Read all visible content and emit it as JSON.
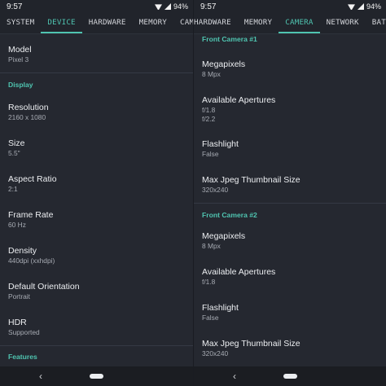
{
  "left": {
    "status": {
      "time": "9:57",
      "battery": "94%"
    },
    "tabs": [
      "SYSTEM",
      "DEVICE",
      "HARDWARE",
      "MEMORY",
      "CAMERA"
    ],
    "model": {
      "label": "Model",
      "value": "Pixel 3"
    },
    "display_section": "Display",
    "display_items": [
      {
        "label": "Resolution",
        "value": "2160 x 1080"
      },
      {
        "label": "Size",
        "value": "5.5\""
      },
      {
        "label": "Aspect Ratio",
        "value": "2:1"
      },
      {
        "label": "Frame Rate",
        "value": "60 Hz"
      },
      {
        "label": "Density",
        "value": "440dpi (xxhdpi)"
      },
      {
        "label": "Default Orientation",
        "value": "Portrait"
      },
      {
        "label": "HDR",
        "value": "Supported"
      }
    ],
    "features_section": "Features",
    "nav": {
      "back_icon": "‹"
    }
  },
  "right": {
    "status": {
      "time": "9:57",
      "battery": "94%"
    },
    "tabs": [
      "HARDWARE",
      "MEMORY",
      "CAMERA",
      "NETWORK",
      "BATTERY"
    ],
    "camera1": {
      "title": "Front Camera #1",
      "megapixels": {
        "label": "Megapixels",
        "value": "8 Mpx"
      },
      "apertures": {
        "label": "Available Apertures",
        "values": [
          "f/1.8",
          "f/2.2"
        ]
      },
      "flashlight": {
        "label": "Flashlight",
        "value": "False"
      },
      "thumb": {
        "label": "Max Jpeg Thumbnail Size",
        "value": "320x240"
      }
    },
    "camera2": {
      "title": "Front Camera #2",
      "megapixels": {
        "label": "Megapixels",
        "value": "8 Mpx"
      },
      "apertures": {
        "label": "Available Apertures",
        "values": [
          "f/1.8"
        ]
      },
      "flashlight": {
        "label": "Flashlight",
        "value": "False"
      },
      "thumb": {
        "label": "Max Jpeg Thumbnail Size",
        "value": "320x240"
      }
    },
    "nav": {
      "back_icon": "‹"
    }
  },
  "colors": {
    "accent": "#4fc4b0",
    "background": "#252830"
  },
  "icons": [
    "wifi-icon",
    "signal-icon",
    "battery-icon",
    "back-icon",
    "home-pill"
  ]
}
